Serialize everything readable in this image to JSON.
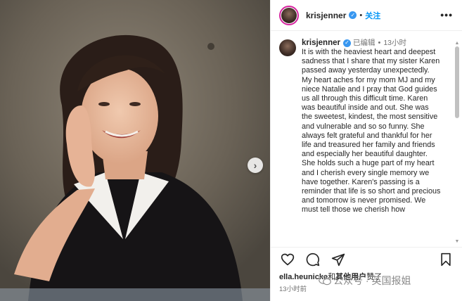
{
  "post": {
    "username": "krisjenner",
    "follow_label": "关注",
    "more_label": "•••",
    "edited_label": "已编辑",
    "time": "13小时",
    "caption": "It is with the heaviest heart and deepest sadness that I share that my sister Karen passed away yesterday unexpectedly. My heart aches for my mom MJ and my niece Natalie and I pray that God guides us all through this difficult time. Karen was beautiful inside and out. She was the sweetest, kindest, the most sensitive and vulnerable and so so funny. She always felt grateful and thankful for her life and treasured her family and friends and especially her beautiful daughter. She holds such a huge part of my heart and I cherish every single memory we have together. Karen's passing is a reminder that life is so short and precious and tomorrow is never promised. We must tell those we cherish how",
    "likes_user": "ella.heunicke",
    "likes_connector": "和",
    "likes_others": "其他用户",
    "likes_suffix": "赞了",
    "posted_ago": "13小时前"
  },
  "watermark": "公众号 · 英国报姐",
  "icons": [
    "verified-badge-icon",
    "heart-icon",
    "comment-icon",
    "share-icon",
    "bookmark-icon",
    "chevron-right-icon"
  ],
  "colors": {
    "accent": "#0095f6",
    "verified": "#3897f0",
    "secondary_text": "#737373"
  }
}
